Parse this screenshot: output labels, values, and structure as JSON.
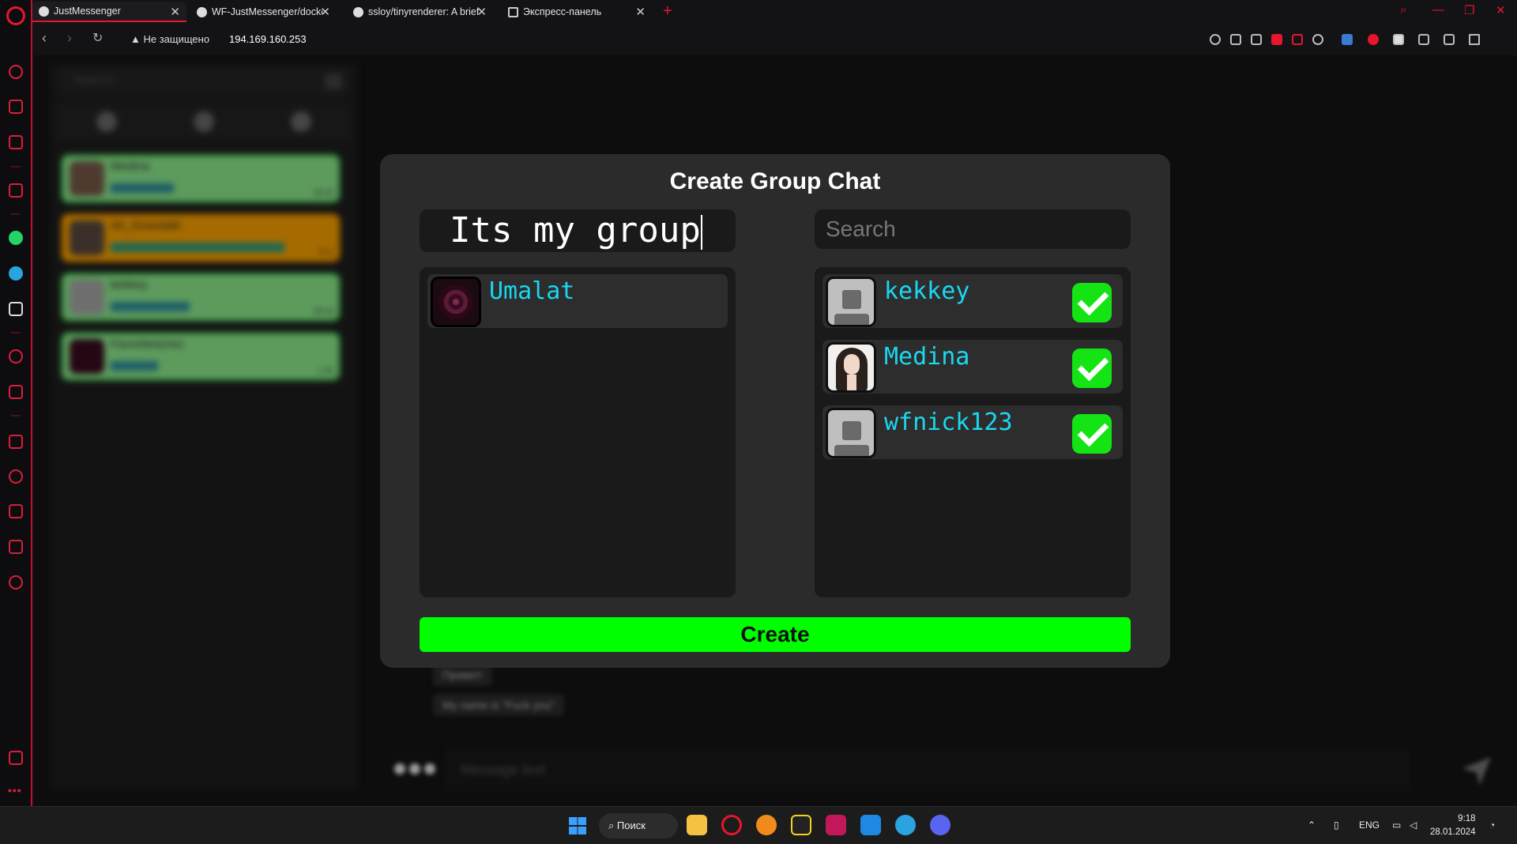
{
  "browser": {
    "tabs": [
      {
        "title": "JustMessenger",
        "active": true
      },
      {
        "title": "WF-JustMessenger/docker",
        "active": false
      },
      {
        "title": "ssloy/tinyrenderer: A brief",
        "active": false
      },
      {
        "title": "Экспресс-панель",
        "active": false
      }
    ],
    "security_label": "Не защищено",
    "url": "194.169.160.253"
  },
  "sidebar": {
    "search_placeholder": "Search",
    "chats": [
      {
        "name": "Medina",
        "time": "09:18"
      },
      {
        "name": "Ah_Dzandaki",
        "time": "9:11"
      },
      {
        "name": "kekkey",
        "time": "09:18"
      },
      {
        "name": "Favorites(me)",
        "time": "1:40"
      }
    ]
  },
  "background_chat": {
    "messages": [
      "Привет!",
      "My name is \"Fuck you\""
    ],
    "composer_placeholder": "Message text"
  },
  "modal": {
    "title": "Create Group Chat",
    "group_name_value": "Its my group",
    "search_placeholder": "Search",
    "selected_members": [
      {
        "name": "Umalat",
        "avatar": "dark-circle-avatar"
      }
    ],
    "available_users": [
      {
        "name": "kekkey",
        "avatar": "default-avatar-icon",
        "checked": true
      },
      {
        "name": "Medina",
        "avatar": "photo-avatar",
        "checked": true
      },
      {
        "name": "wfnick123",
        "avatar": "default-avatar-icon",
        "checked": true
      }
    ],
    "create_label": "Create",
    "accent_color": "#00ff00",
    "name_color": "#19d8f0"
  },
  "taskbar": {
    "search_label": "Поиск",
    "language": "ENG",
    "time": "9:18",
    "date": "28.01.2024"
  }
}
